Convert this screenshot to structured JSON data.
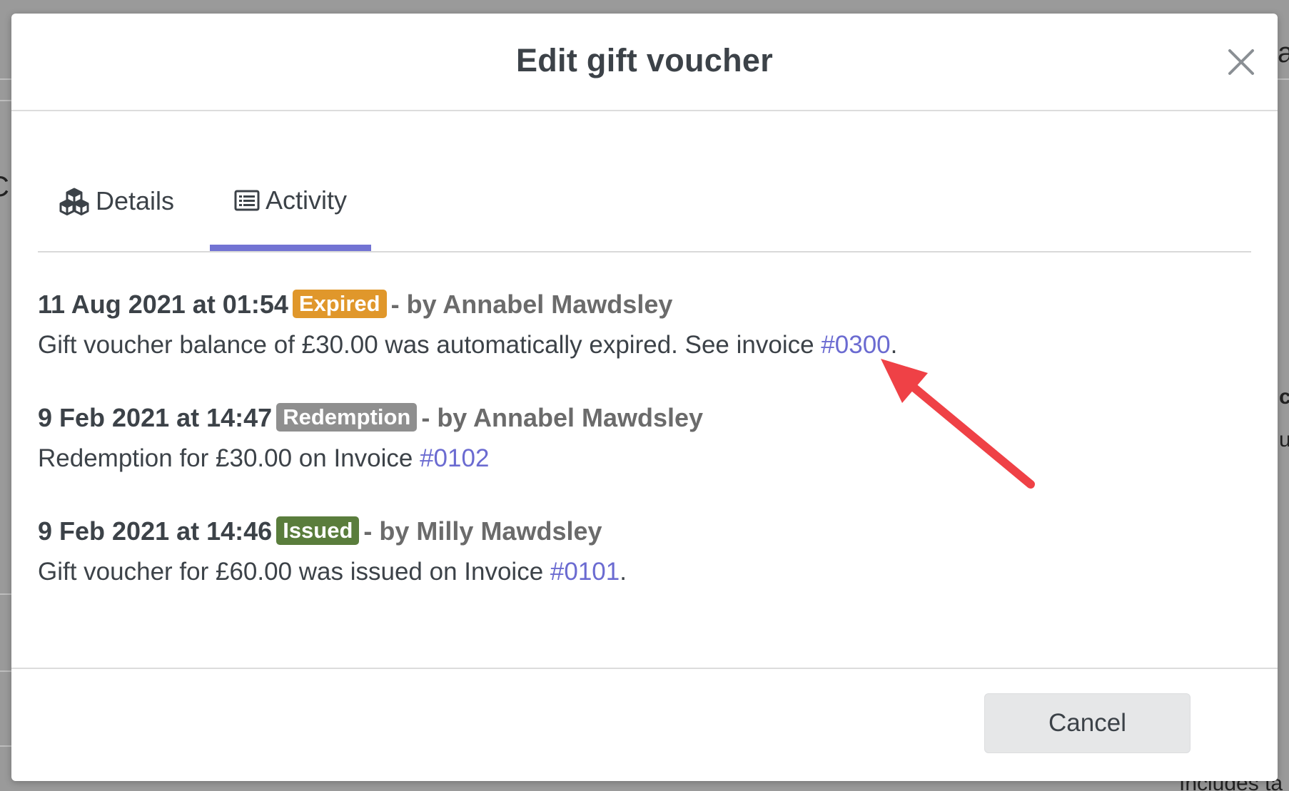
{
  "background": {
    "fragments": [
      "a",
      "C",
      "c",
      "u",
      "Includes ta"
    ]
  },
  "modal": {
    "title": "Edit gift voucher",
    "close_icon": "close-icon",
    "tabs": [
      {
        "label": "Details",
        "icon": "cubes-icon",
        "active": false
      },
      {
        "label": "Activity",
        "icon": "list-icon",
        "active": true
      }
    ],
    "accent_color": "#7273d3",
    "entries": [
      {
        "timestamp": "11 Aug 2021 at 01:54",
        "badge": "Expired",
        "badge_color": "#e0972b",
        "by": "- by Annabel Mawdsley",
        "text_before": "Gift voucher balance of £30.00 was automatically expired. See invoice ",
        "link": "#0300",
        "text_after": "."
      },
      {
        "timestamp": "9 Feb 2021 at 14:47",
        "badge": "Redemption",
        "badge_color": "#8f8f8f",
        "by": "- by Annabel Mawdsley",
        "text_before": "Redemption for £30.00 on Invoice ",
        "link": "#0102",
        "text_after": ""
      },
      {
        "timestamp": "9 Feb 2021 at 14:46",
        "badge": "Issued",
        "badge_color": "#5a7d3c",
        "by": "- by Milly Mawdsley",
        "text_before": "Gift voucher for £60.00 was issued on Invoice ",
        "link": "#0101",
        "text_after": "."
      }
    ],
    "annotation_arrow_color": "#ef4146",
    "cancel_label": "Cancel"
  }
}
